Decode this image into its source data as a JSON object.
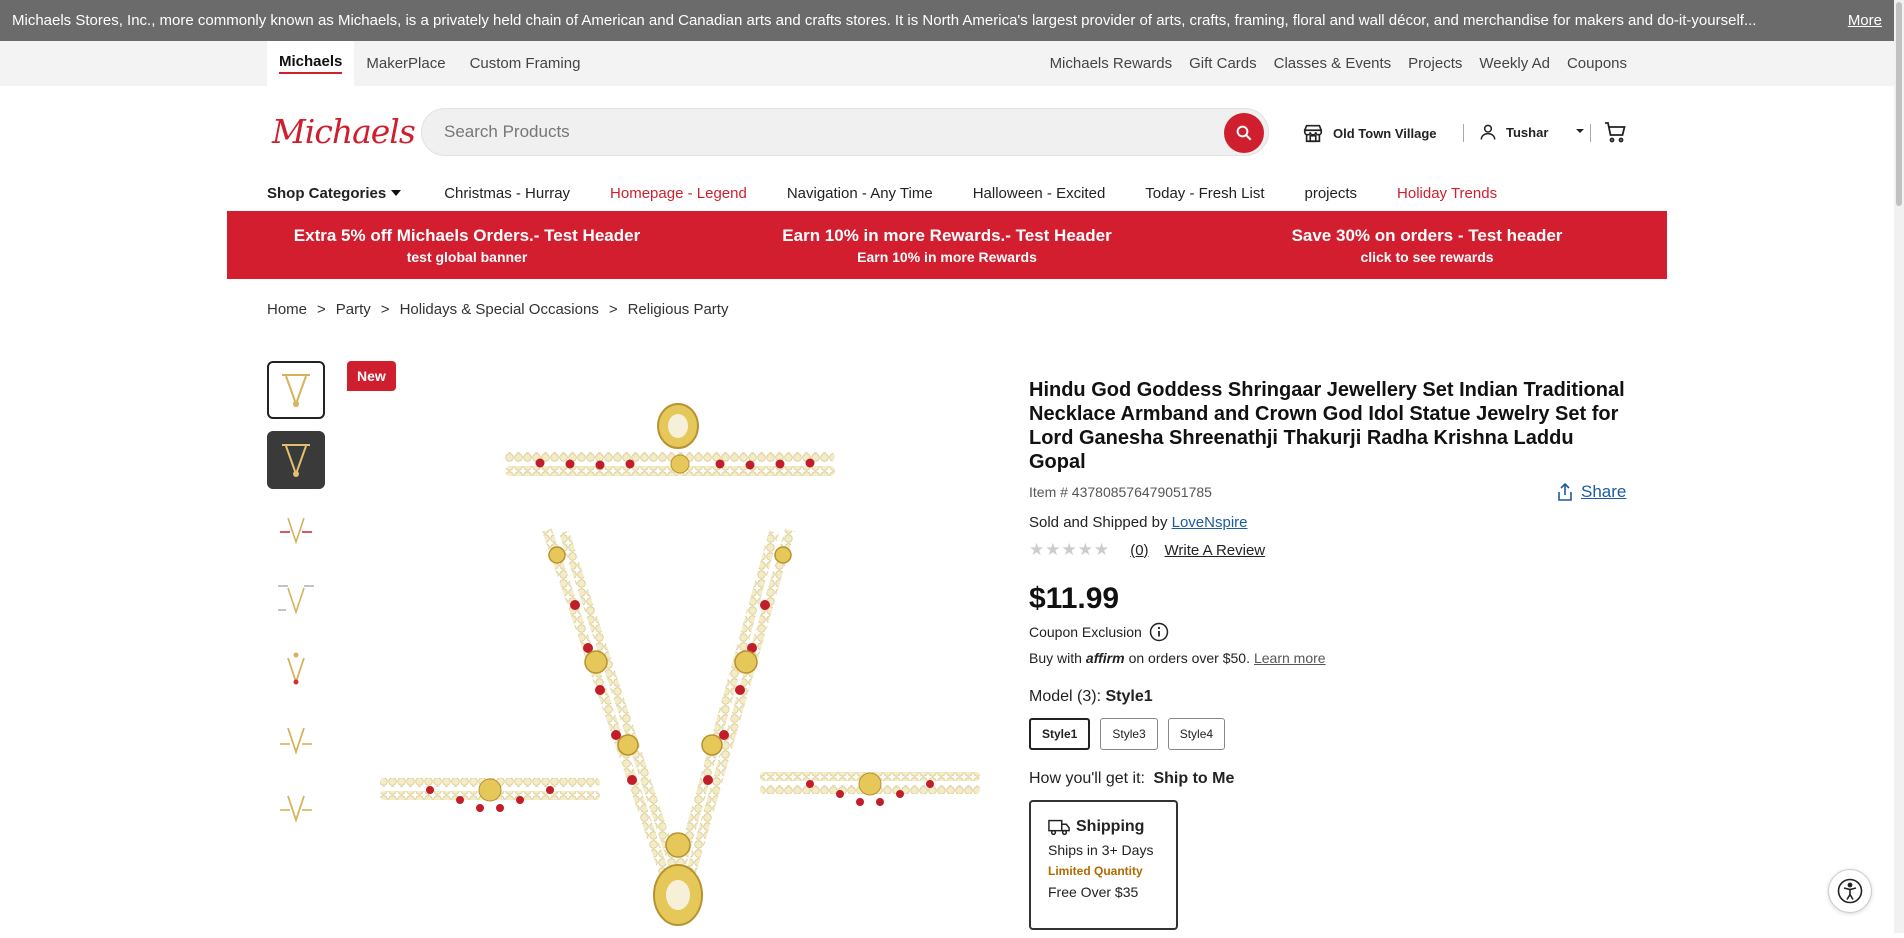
{
  "announcement": {
    "text": "Michaels Stores, Inc., more commonly known as Michaels, is a privately held chain of American and Canadian arts and crafts stores. It is North America's largest provider of arts, crafts, framing, floral and wall décor, and merchandise for makers and do-it-yourself...",
    "more_label": "More"
  },
  "top_nav": {
    "tabs": [
      "Michaels",
      "MakerPlace",
      "Custom Framing"
    ],
    "links": [
      "Michaels Rewards",
      "Gift Cards",
      "Classes & Events",
      "Projects",
      "Weekly Ad",
      "Coupons"
    ]
  },
  "header": {
    "logo_text": "Michaels",
    "search_placeholder": "Search Products",
    "store_name": "Old Town Village",
    "user_name": "Tushar"
  },
  "category_nav": {
    "shop_categories": "Shop Categories",
    "items": [
      {
        "label": "Christmas - Hurray",
        "highlight": false
      },
      {
        "label": "Homepage - Legend",
        "highlight": true
      },
      {
        "label": "Navigation - Any Time",
        "highlight": false
      },
      {
        "label": "Halloween - Excited",
        "highlight": false
      },
      {
        "label": "Today - Fresh List",
        "highlight": false
      },
      {
        "label": "projects",
        "highlight": false
      },
      {
        "label": "Holiday Trends",
        "highlight": true
      }
    ]
  },
  "promo_banner": [
    {
      "title": "Extra 5% off Michaels Orders.- Test Header",
      "subtitle": "test global banner"
    },
    {
      "title": "Earn 10% in more Rewards.- Test Header",
      "subtitle": "Earn 10% in more Rewards"
    },
    {
      "title": "Save 30% on orders - Test header",
      "subtitle": "click to see rewards"
    }
  ],
  "breadcrumbs": [
    "Home",
    "Party",
    "Holidays & Special Occasions",
    "Religious Party"
  ],
  "breadcrumb_separator": ">",
  "product": {
    "badge": "New",
    "title": "Hindu God Goddess Shringaar Jewellery Set Indian Traditional Necklace Armband and Crown God Idol Statue Jewelry Set for Lord Ganesha Shreenathji Thakurji Radha Krishna Laddu Gopal",
    "item_number": "Item # 437808576479051785",
    "share_label": "Share",
    "sold_by_prefix": "Sold and Shipped by",
    "seller": "LoveNspire",
    "stars": "★★★★★",
    "review_count": "(0)",
    "write_review": "Write A Review",
    "price": "$11.99",
    "coupon_exclusion": "Coupon Exclusion",
    "affirm_prefix": "Buy with",
    "affirm_logo": "affirm",
    "affirm_suffix": "on orders over $50.",
    "learn_more": "Learn more",
    "model_label": "Model (3):",
    "model_selected": "Style1",
    "styles": [
      "Style1",
      "Style3",
      "Style4"
    ],
    "how_label": "How you'll get it:",
    "how_value": "Ship to Me",
    "shipping": {
      "title": "Shipping",
      "eta": "Ships in 3+ Days",
      "stock": "Limited Quantity",
      "free": "Free Over $35"
    }
  },
  "colors": {
    "brand_red": "#cf1f2e",
    "link_blue": "#1b5c9e",
    "announcement_bg": "#6b6b6b"
  }
}
